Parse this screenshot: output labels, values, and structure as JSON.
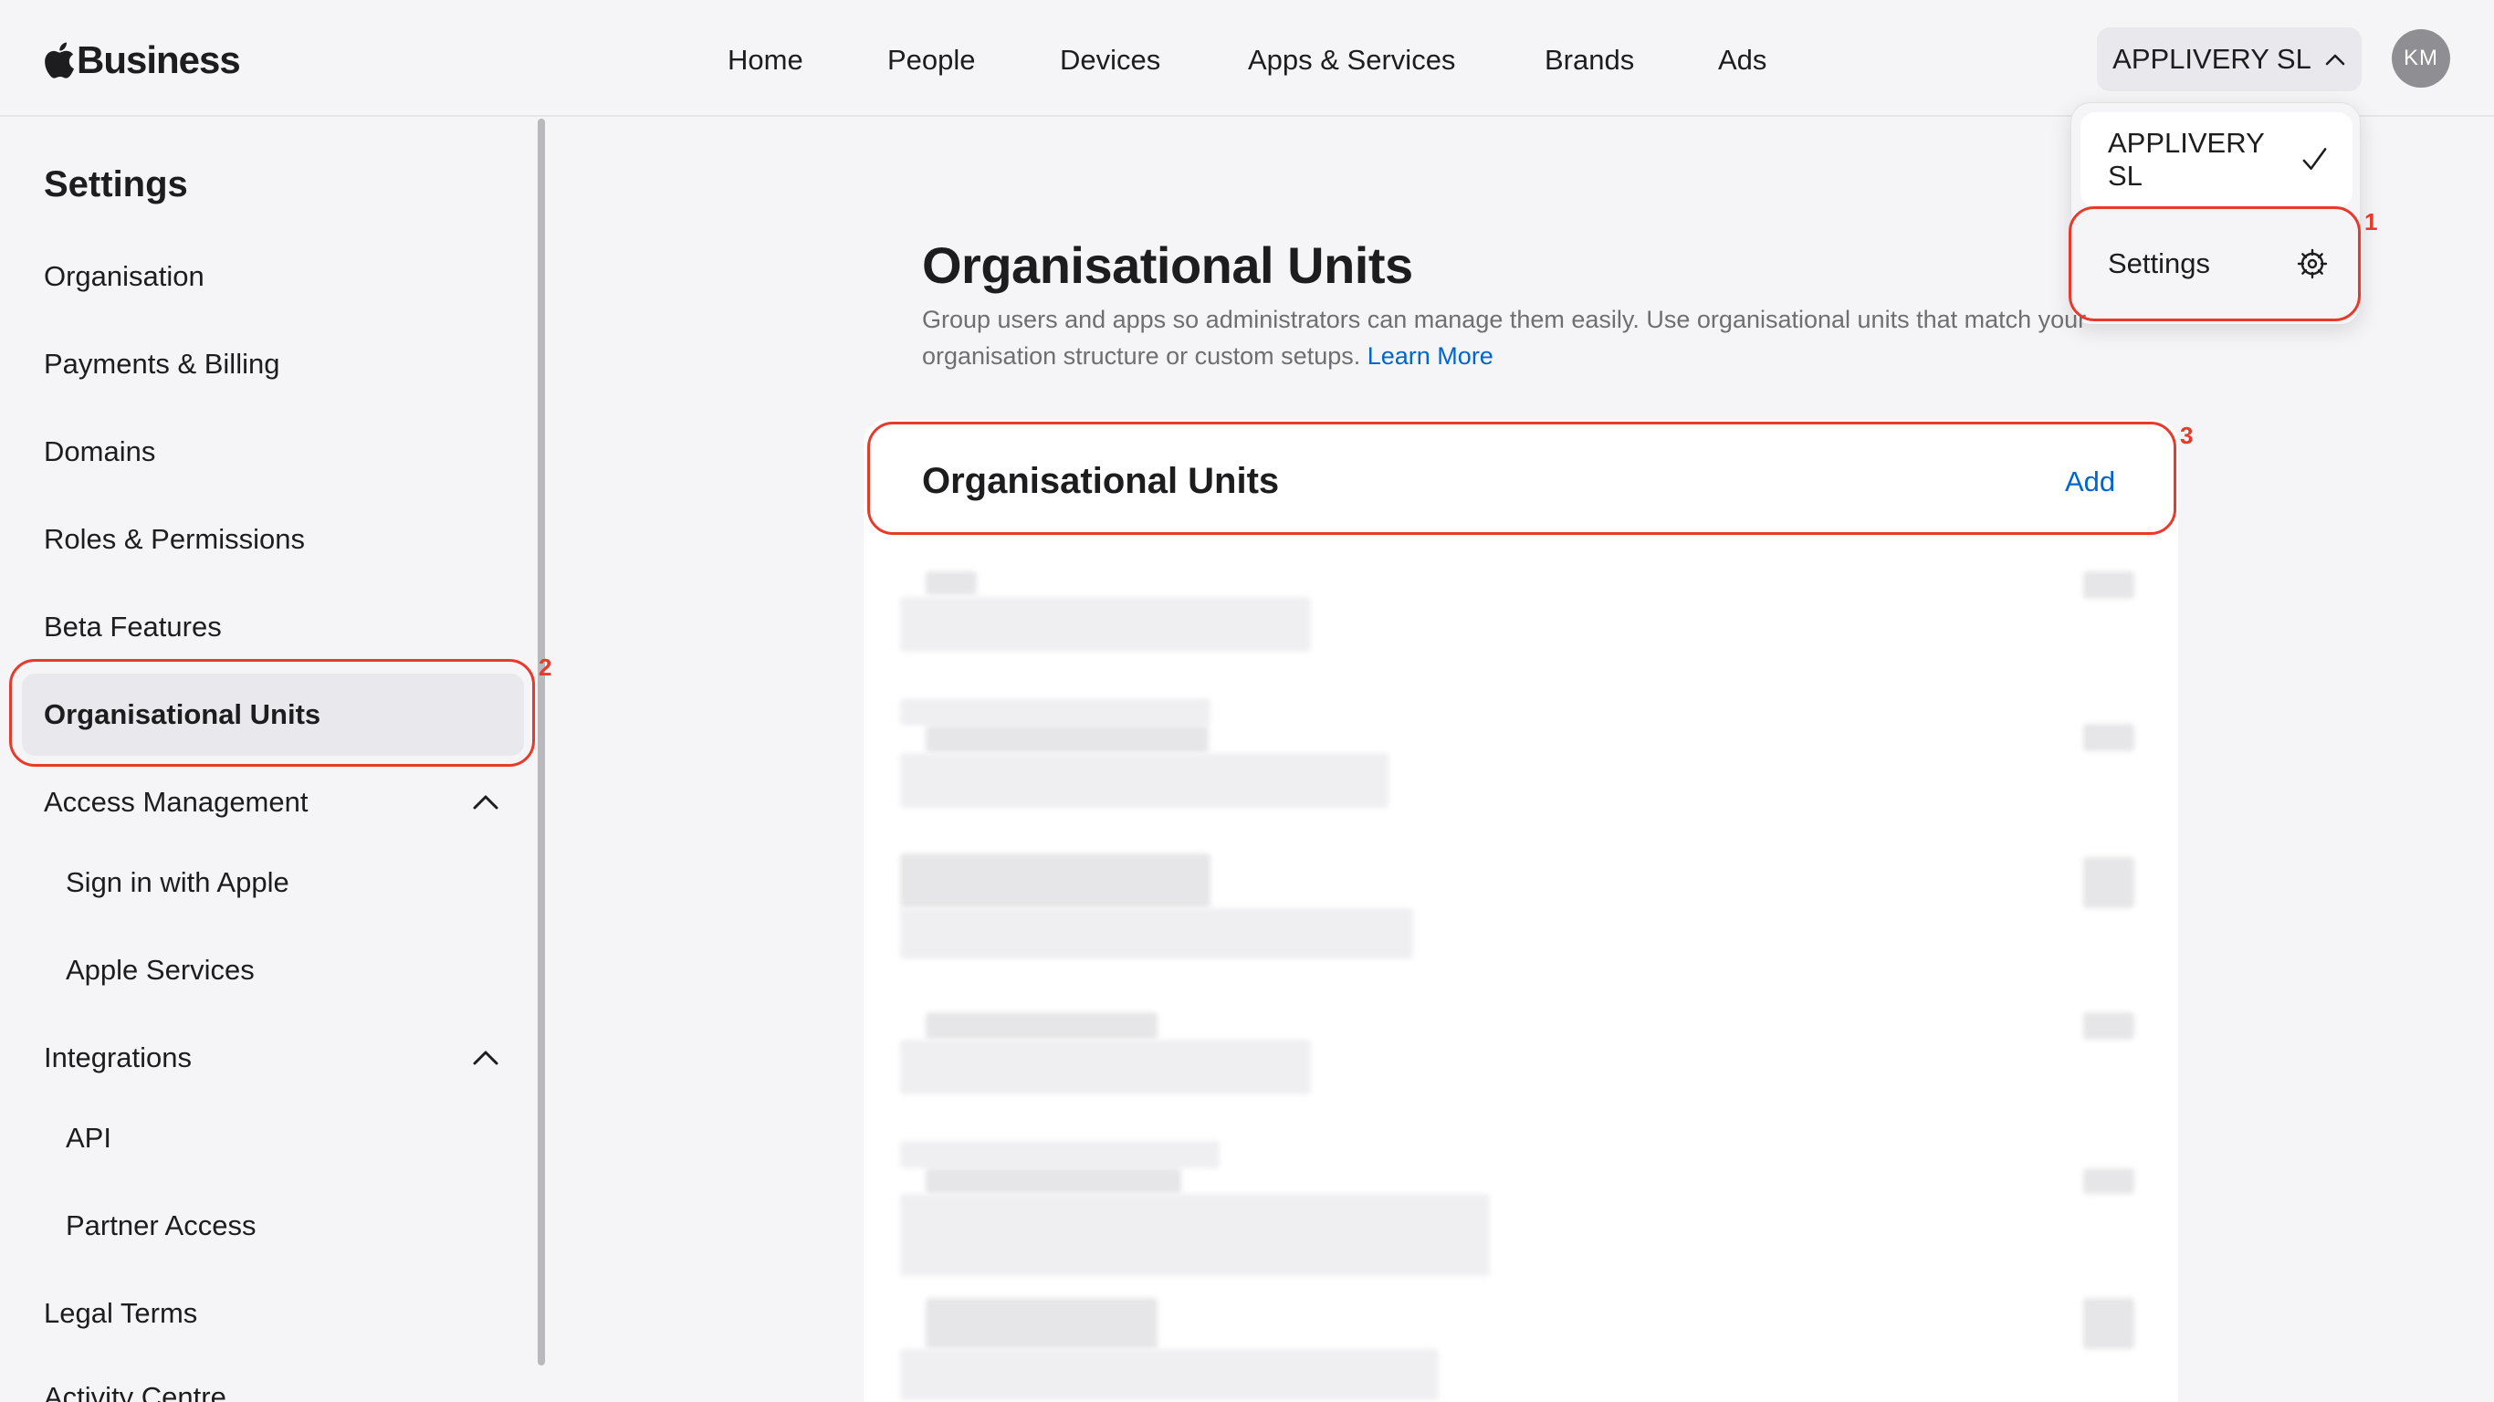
{
  "brand": {
    "name": "Business"
  },
  "nav": {
    "items": [
      "Home",
      "People",
      "Devices",
      "Apps & Services",
      "Brands",
      "Ads"
    ]
  },
  "org_selector": {
    "label": "APPLIVERY SL"
  },
  "avatar": {
    "initials": "KM"
  },
  "dropdown": {
    "org_label": "APPLIVERY SL",
    "settings_label": "Settings"
  },
  "sidebar": {
    "title": "Settings",
    "items": [
      "Organisation",
      "Payments & Billing",
      "Domains",
      "Roles & Permissions",
      "Beta Features",
      "Organisational Units",
      "Access Management",
      "Sign in with Apple",
      "Apple Services",
      "Integrations",
      "API",
      "Partner Access",
      "Legal Terms",
      "Activity Centre"
    ]
  },
  "main": {
    "title": "Organisational Units",
    "description": "Group users and apps so administrators can manage them easily. Use organisational units that match your organisation structure or custom setups.",
    "learn_more": "Learn More",
    "card_title": "Organisational Units",
    "add_label": "Add"
  },
  "annotations": [
    "1",
    "2",
    "3"
  ],
  "colors": {
    "accent": "#0066cc",
    "annotation": "#e8392b",
    "active_bg": "#e8e8ed"
  }
}
